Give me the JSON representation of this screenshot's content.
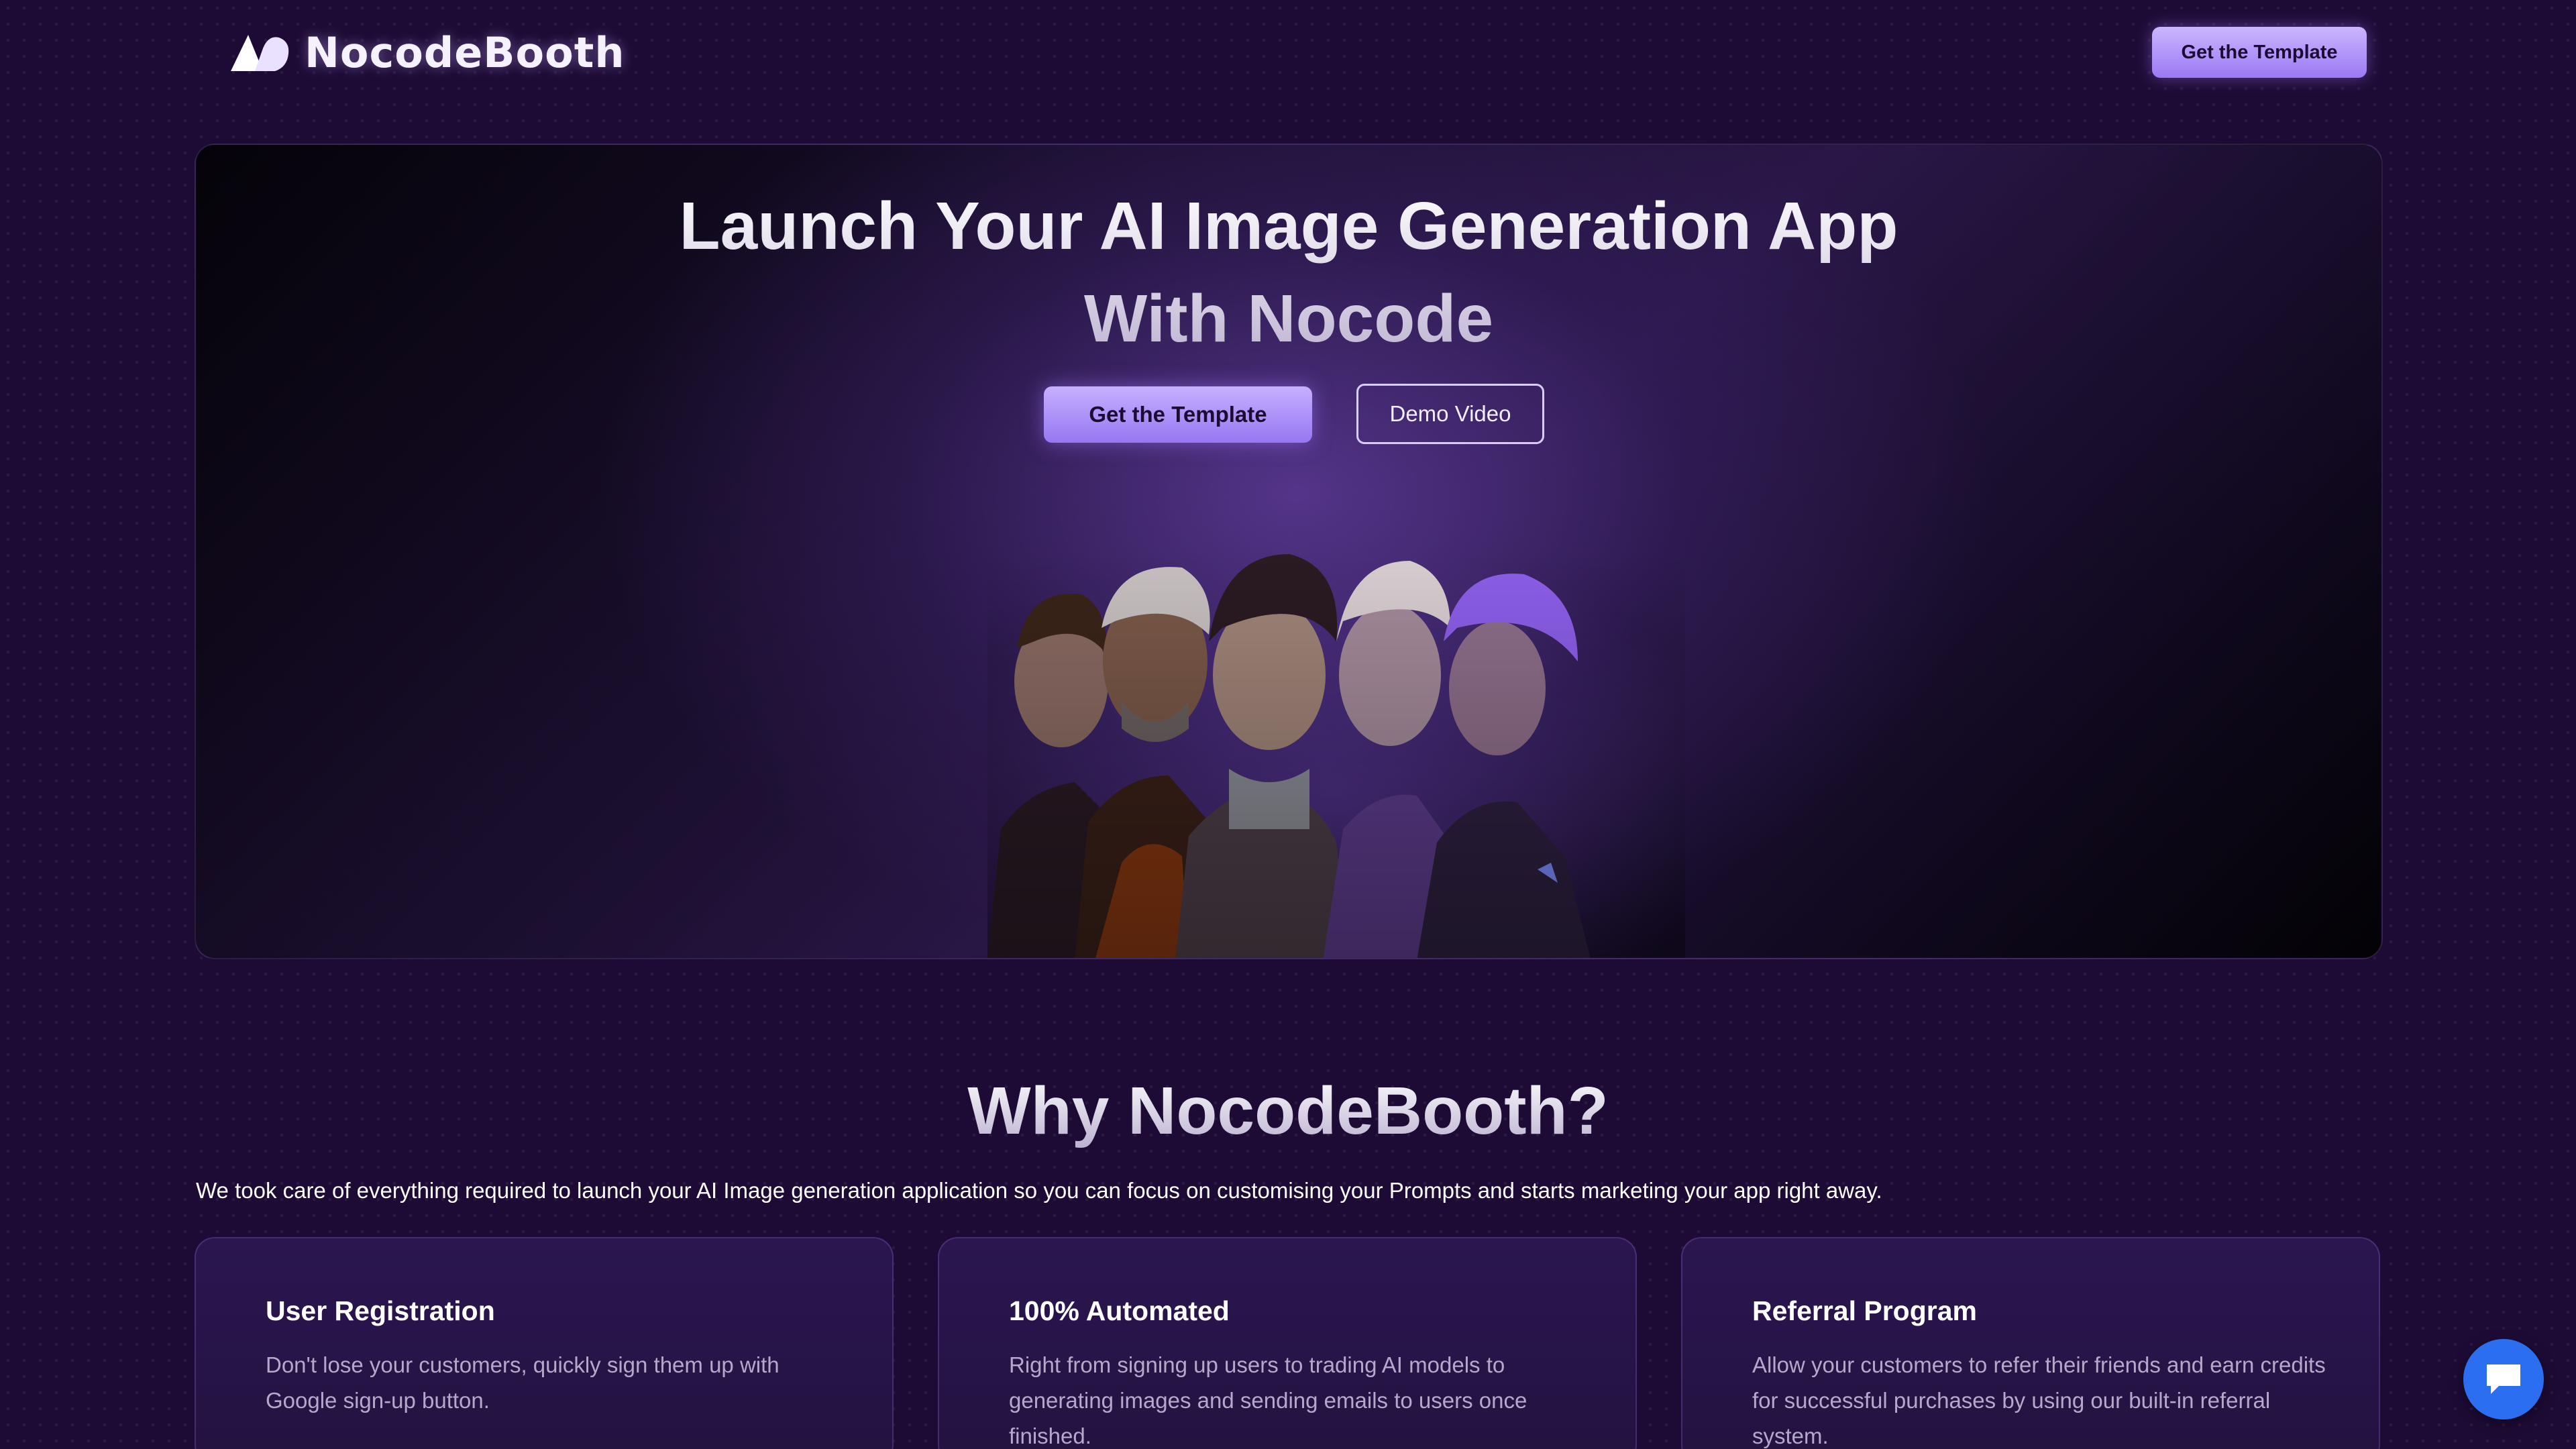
{
  "brand": {
    "name": "NocodeBooth"
  },
  "nav": {
    "cta_label": "Get the Template"
  },
  "hero": {
    "title_line1": "Launch Your AI Image Generation App",
    "title_line2": "With Nocode",
    "primary_button": "Get the Template",
    "secondary_button": "Demo Video",
    "image_subject": "five stylized sci-fi character portraits"
  },
  "why": {
    "title": "Why NocodeBooth?",
    "subtitle": "We took care of everything required to launch your AI Image generation application so you can focus on customising your Prompts and starts marketing your app right away.",
    "cards": [
      {
        "title": "User Registration",
        "description": "Don't lose your customers, quickly sign them up with Google sign-up button."
      },
      {
        "title": "100% Automated",
        "description": "Right from signing up users to trading AI models to generating images and sending emails to users once finished."
      },
      {
        "title": "Referral Program",
        "description": "Allow your customers to refer their friends and earn credits for successful purchases by using our built-in referral system."
      }
    ]
  },
  "chat": {
    "icon": "chat-bubble-icon"
  },
  "colors": {
    "background": "#1d0b35",
    "accent": "#9b79f4",
    "chat_button": "#2b6ef0"
  }
}
